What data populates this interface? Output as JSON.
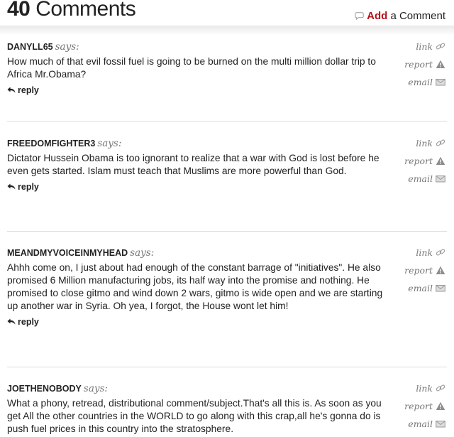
{
  "header": {
    "count": "40",
    "count_label": "Comments",
    "add_label": "Add",
    "add_suffix": "a Comment",
    "add_icon": "speech-bubble-icon"
  },
  "actions": {
    "link": "link",
    "report": "report",
    "email": "email",
    "reply": "reply",
    "says": "says:"
  },
  "comments": [
    {
      "author": "DANYLL65",
      "text": "How much of that evil fossil fuel is going to be burned on the multi million dollar trip to Africa Mr.Obama?"
    },
    {
      "author": "FREEDOMFIGHTER3",
      "text": "Dictator Hussein Obama is too ignorant to realize that a war with God is lost before he even gets started. Islam must teach that Muslims are more powerful than God."
    },
    {
      "author": "MEANDMYVOICEINMYHEAD",
      "text": "Ahhh come on, I just about had enough of the constant barrage of \"initiatives\". He also promised 6 Million manufacturing jobs, its half way into the promise and nothing. He promised to close gitmo and wind down 2 wars, gitmo is wide open and we are starting up another war in Syria. Oh yea, I forgot, the House wont let him!"
    },
    {
      "author": "JOETHENOBODY",
      "text": "What a phony, retread, distributional comment/subject.That's all this is. As soon as you get All the other countries in the WORLD to go along with this crap,all he's gonna do is push fuel prices in this country into the stratosphere."
    }
  ]
}
